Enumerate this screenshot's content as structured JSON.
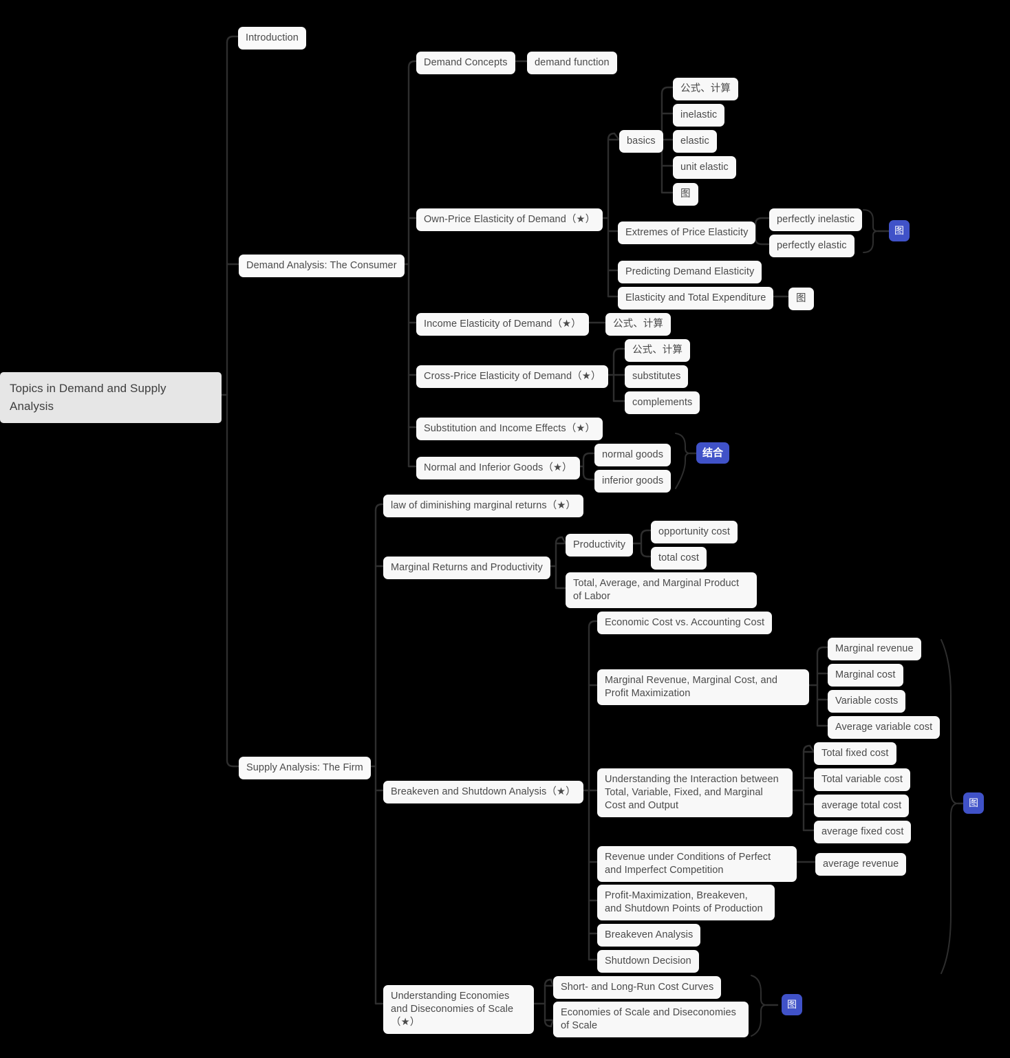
{
  "diagram": {
    "title": "Topics in Demand and Supply Analysis",
    "type": "mindmap",
    "background_color": "#000000",
    "node_color": "#f8f8f8",
    "root_color": "#e6e6e6",
    "accent_color": "#4052c8",
    "text_color": "#4a4a4a",
    "link_color": "#2e2e2e"
  },
  "root": {
    "label": "Topics in Demand and Supply Analysis"
  },
  "branches": {
    "introduction": {
      "label": "Introduction"
    },
    "demand_analysis": {
      "label": "Demand Analysis: The Consumer"
    },
    "supply_analysis": {
      "label": "Supply Analysis: The Firm"
    }
  },
  "demand": {
    "demand_concepts": {
      "label": "Demand Concepts"
    },
    "demand_function": {
      "label": "demand function"
    },
    "own_price": {
      "label": "Own-Price Elasticity of Demand（★）"
    },
    "basics": {
      "label": "basics"
    },
    "basics_formula": {
      "label": "公式、计算"
    },
    "inelastic": {
      "label": "inelastic"
    },
    "elastic": {
      "label": "elastic"
    },
    "unit_elastic": {
      "label": "unit elastic"
    },
    "basics_tu": {
      "label": "图"
    },
    "extremes": {
      "label": "Extremes of Price Elasticity"
    },
    "perfectly_inelastic": {
      "label": "perfectly inelastic"
    },
    "perfectly_elastic": {
      "label": "perfectly elastic"
    },
    "extremes_badge": {
      "label": "图"
    },
    "predicting": {
      "label": "Predicting Demand Elasticity"
    },
    "total_expenditure": {
      "label": "Elasticity and Total Expenditure"
    },
    "total_expenditure_tu": {
      "label": "图"
    },
    "income_elasticity": {
      "label": "Income Elasticity of Demand（★）"
    },
    "income_formula": {
      "label": "公式、计算"
    },
    "cross_price": {
      "label": "Cross-Price Elasticity of Demand（★）"
    },
    "cross_formula": {
      "label": "公式、计算"
    },
    "substitutes": {
      "label": "substitutes"
    },
    "complements": {
      "label": "complements"
    },
    "substitution_income": {
      "label": "Substitution and Income Effects（★）"
    },
    "normal_inferior": {
      "label": "Normal and Inferior Goods（★）"
    },
    "normal_goods": {
      "label": "normal goods"
    },
    "inferior_goods": {
      "label": "inferior goods"
    },
    "combine_badge": {
      "label": "结合"
    }
  },
  "supply": {
    "diminishing_returns": {
      "label": "law of diminishing marginal returns（★）"
    },
    "marginal_returns": {
      "label": "Marginal Returns and Productivity"
    },
    "productivity": {
      "label": "Productivity"
    },
    "opportunity_cost": {
      "label": "opportunity cost"
    },
    "total_cost": {
      "label": "total cost"
    },
    "tamp_labor": {
      "label": "Total, Average, and Marginal Product of Labor"
    },
    "breakeven_shutdown": {
      "label": "Breakeven and Shutdown Analysis（★）"
    },
    "economic_vs_accounting": {
      "label": "Economic Cost vs. Accounting Cost"
    },
    "mr_mc_profit": {
      "label": "Marginal Revenue, Marginal Cost, and Profit Maximization"
    },
    "marginal_revenue": {
      "label": "Marginal revenue"
    },
    "marginal_cost": {
      "label": "Marginal cost"
    },
    "variable_costs": {
      "label": "Variable costs"
    },
    "average_variable_cost": {
      "label": "Average variable cost"
    },
    "understanding_interaction": {
      "label": "Understanding the Interaction between Total, Variable, Fixed, and Marginal Cost and Output"
    },
    "total_fixed_cost": {
      "label": "Total fixed cost"
    },
    "total_variable_cost": {
      "label": "Total variable cost"
    },
    "average_total_cost": {
      "label": "average total cost"
    },
    "average_fixed_cost": {
      "label": "average fixed cost"
    },
    "revenue_competition": {
      "label": "Revenue under Conditions of Perfect and Imperfect Competition"
    },
    "average_revenue": {
      "label": "average revenue"
    },
    "profit_max_points": {
      "label": "Profit-Maximization, Breakeven, and Shutdown Points of Production"
    },
    "breakeven_analysis": {
      "label": "Breakeven Analysis"
    },
    "shutdown_decision": {
      "label": "Shutdown Decision"
    },
    "supply_group_badge": {
      "label": "图"
    },
    "economies_scale": {
      "label": "Understanding Economies and Diseconomies of Scale（★）"
    },
    "cost_curves": {
      "label": "Short- and Long-Run Cost Curves"
    },
    "eos_dos": {
      "label": "Economies of Scale and Diseconomies of Scale"
    },
    "economies_badge": {
      "label": "图"
    }
  }
}
